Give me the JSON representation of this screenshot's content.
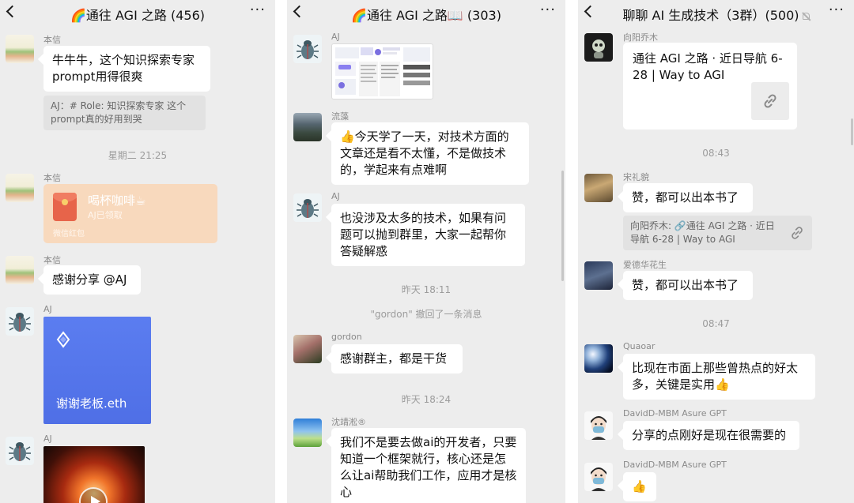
{
  "panel1": {
    "title": "🌈通往 AGI 之路 (456)",
    "more": "···",
    "messages": {
      "m1_name": "本信",
      "m1_text": "牛牛牛，这个知识探索专家prompt用得很爽",
      "m1_quote": "AJ：# Role: 知识探索专家  这个prompt真的好用到哭",
      "time1": "星期二 21:25",
      "m2_name": "本信",
      "rp_title": "喝杯咖啡☕",
      "rp_sub": "AJ已领取",
      "rp_foot": "微信红包",
      "m3_name": "本信",
      "m3_text": "感谢分享 @AJ",
      "m4_name": "AJ",
      "m4_caption": "谢谢老板.eth",
      "m5_name": "AJ"
    }
  },
  "panel2": {
    "title": "🌈通往 AGI 之路📖 (303)",
    "more": "···",
    "messages": {
      "m1_name": "AJ",
      "m2_name": "流藻",
      "m2_text": "👍今天学了一天，对技术方面的文章还是看不太懂，不是做技术的，学起来有点难啊",
      "m3_name": "AJ",
      "m3_text": "也没涉及太多的技术，如果有问题可以抛到群里，大家一起帮你答疑解惑",
      "time1": "昨天 18:11",
      "recall": "\"gordon\" 撤回了一条消息",
      "m4_name": "gordon",
      "m4_text": "感谢群主，都是干货",
      "time2": "昨天 18:24",
      "m5_name": "沈靖淞®",
      "m5_text": "我们不是要去做ai的开发者，只要知道一个框架就行，核心还是怎么让ai帮助我们工作，应用才是核心"
    }
  },
  "panel3": {
    "title": "聊聊 AI 生成技术（3群）(500)",
    "more": "···",
    "messages": {
      "m1_name": "向阳乔木",
      "m1_link_title": "通往 AGI 之路 · 近日导航 6-28 | Way to AGI",
      "time1": "08:43",
      "m2_name": "宋礼貌",
      "m2_text": "赞，都可以出本书了",
      "m2_quote": "向阳乔木: 🔗通往 AGI 之路 · 近日导航 6-28 | Way to AGI",
      "m3_name": "爱德华花生",
      "m3_text": "赞，都可以出本书了",
      "time2": "08:47",
      "m4_name": "Quaoar",
      "m4_text": "比现在市面上那些曾热点的好太多，关键是实用👍",
      "m5_name": "DavidD-MBM Asure GPT",
      "m5_text": "分享的点刚好是现在很需要的",
      "m6_name": "DavidD-MBM Asure GPT",
      "m6_text": "👍"
    }
  },
  "colors": {
    "chat_bg": "#ededed",
    "bubble": "#ffffff",
    "quote_bg": "#e2e2e2",
    "red_packet": "#f8d9bd"
  },
  "icons": [
    "back-arrow-icon",
    "more-dots-icon",
    "mute-bell-icon",
    "link-icon",
    "play-icon",
    "ethereum-icon"
  ]
}
